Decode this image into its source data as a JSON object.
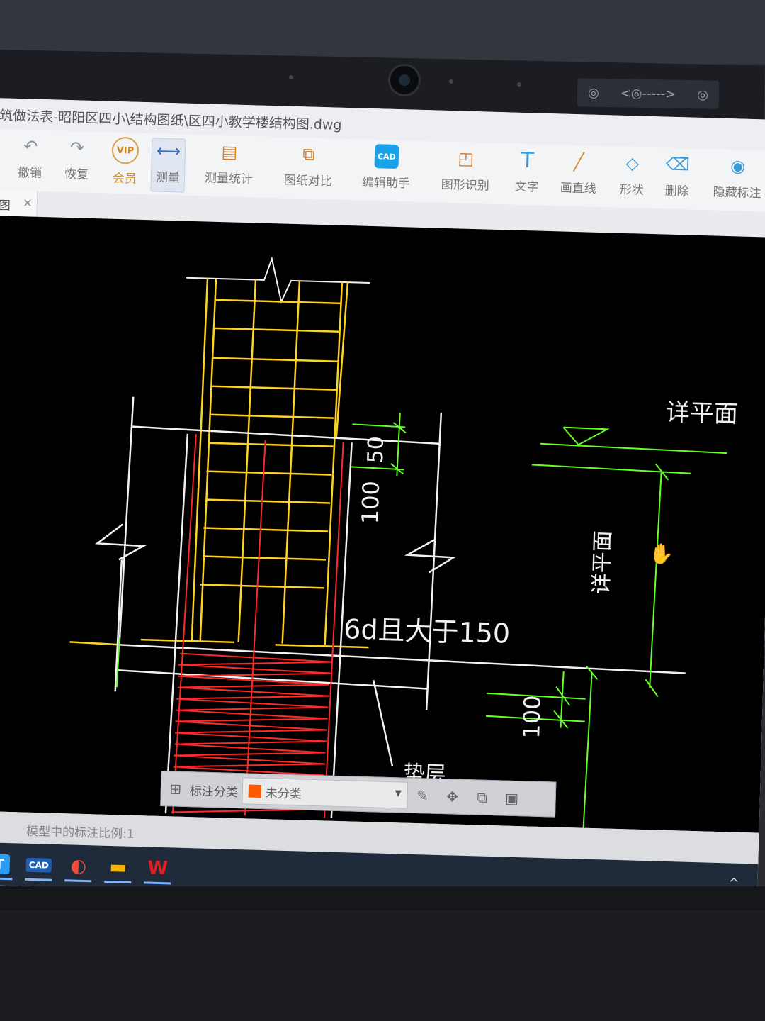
{
  "window": {
    "title": "筑做法表-昭阳区四小\\结构图纸\\区四小教学楼结构图.dwg"
  },
  "webcam_bar": {
    "left_glyph": "◎",
    "arrows": "<◎----->",
    "right_glyph": "◎"
  },
  "toolbar": {
    "items": [
      {
        "label": "撤销",
        "icon": "undo-icon",
        "glyph": "↶"
      },
      {
        "label": "恢复",
        "icon": "redo-icon",
        "glyph": "↷"
      },
      {
        "label": "会员",
        "icon": "vip-icon",
        "glyph": "VIP"
      },
      {
        "label": "测量",
        "icon": "measure-icon",
        "glyph": "⟷"
      },
      {
        "label": "测量统计",
        "icon": "measure-stats-icon",
        "glyph": "▤"
      },
      {
        "label": "图纸对比",
        "icon": "compare-icon",
        "glyph": "⧉"
      },
      {
        "label": "编辑助手",
        "icon": "edit-assistant-icon",
        "glyph": "CAD"
      },
      {
        "label": "图形识别",
        "icon": "shape-recognize-icon",
        "glyph": "◰"
      },
      {
        "label": "文字",
        "icon": "text-icon",
        "glyph": "T"
      },
      {
        "label": "画直线",
        "icon": "line-icon",
        "glyph": "╱"
      },
      {
        "label": "形状",
        "icon": "shape-icon",
        "glyph": "◇"
      },
      {
        "label": "删除",
        "icon": "eraser-icon",
        "glyph": "⌫"
      },
      {
        "label": "隐藏标注",
        "icon": "hide-annotation-icon",
        "glyph": "◉"
      }
    ]
  },
  "tab": {
    "label": "图",
    "close": "×"
  },
  "drawing": {
    "labels": {
      "plane_top": "详平面",
      "plane_side": "详平面",
      "dim_50": "50",
      "dim_100_a": "100",
      "dim_100_b": "100",
      "anchor_note": "6d且大于150",
      "layer_note": "垫层"
    },
    "colors": {
      "yellow": "#ffd21f",
      "red": "#ff2a2a",
      "white": "#f2f2f2",
      "green": "#66ff2a"
    }
  },
  "float_bar": {
    "grid_icon": "⊞",
    "label": "标注分类",
    "select_value": "未分类",
    "swatch_color": "#ff5a00",
    "caret": "▼",
    "actions": [
      {
        "name": "edit-icon",
        "glyph": "✎"
      },
      {
        "name": "move-icon",
        "glyph": "✥"
      },
      {
        "name": "copy-icon",
        "glyph": "⧉"
      },
      {
        "name": "paste-icon",
        "glyph": "▣"
      }
    ]
  },
  "status": {
    "text": "模型中的标注比例:1"
  },
  "taskbar": {
    "apps": [
      {
        "name": "taskbar-app-t",
        "glyph": "T",
        "bg": "#2a9df4"
      },
      {
        "name": "taskbar-app-cad",
        "glyph": "CAD",
        "bg": "#1e5fb3"
      },
      {
        "name": "taskbar-app-browser",
        "glyph": "◐",
        "bg": "#f04c3e"
      },
      {
        "name": "taskbar-app-folder",
        "glyph": "▬",
        "bg": "#f5b400"
      },
      {
        "name": "taskbar-app-wps",
        "glyph": "W",
        "bg": "#e02020"
      }
    ],
    "tray_caret": "^"
  }
}
